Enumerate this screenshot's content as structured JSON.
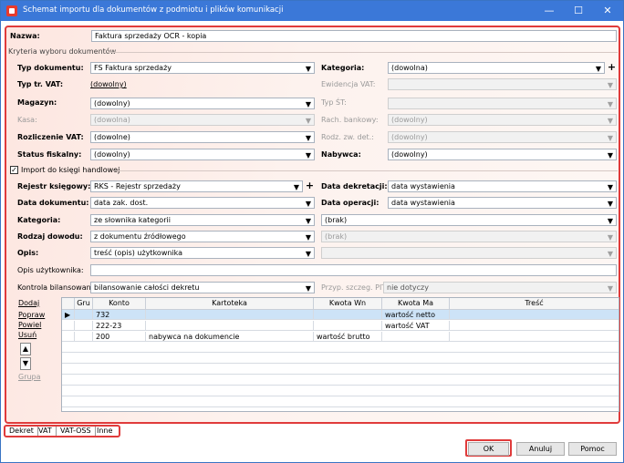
{
  "window": {
    "title": "Schemat importu dla dokumentów z podmiotu i plików komunikacji",
    "minimize": "—",
    "maximize": "☐",
    "close": "✕",
    "accent": "#3b78d8",
    "highlight": "#e03b3b"
  },
  "form": {
    "name_label": "Nazwa:",
    "name_value": "Faktura sprzedaży OCR - kopia",
    "criteria_header": "Kryteria wyboru dokumentów",
    "typ_dokumentu_label": "Typ dokumentu:",
    "typ_dokumentu_value": "FS Faktura sprzedaży",
    "kategoria_label": "Kategoria:",
    "kategoria_value": "(dowolna)",
    "typ_vat_label": "Typ tr. VAT:",
    "typ_vat_value": "(dowolny)",
    "ewidencja_vat_label": "Ewidencja VAT:",
    "ewidencja_vat_value": "",
    "magazyn_label": "Magazyn:",
    "magazyn_value": "(dowolny)",
    "typ_st_label": "Typ ŚT:",
    "typ_st_value": "",
    "kasa_label": "Kasa:",
    "kasa_value": "(dowolna)",
    "rach_bank_label": "Rach. bankowy:",
    "rach_bank_value": "(dowolny)",
    "rozliczenie_vat_label": "Rozliczenie VAT:",
    "rozliczenie_vat_value": "(dowolne)",
    "rodz_zw_label": "Rodz. zw. det.:",
    "rodz_zw_value": "(dowolny)",
    "status_fiskalny_label": "Status fiskalny:",
    "status_fiskalny_value": "(dowolny)",
    "nabywca_label": "Nabywca:",
    "nabywca_value": "(dowolny)",
    "import_checkbox_label": "Import do księgi handlowej",
    "import_checked": "✓",
    "rejestr_label": "Rejestr księgowy:",
    "rejestr_value": "RKS - Rejestr sprzedaży",
    "data_dekretacji_label": "Data dekretacji:",
    "data_dekretacji_value": "data wystawienia",
    "data_dokumentu_label": "Data dokumentu:",
    "data_dokumentu_value": "data zak. dost.",
    "data_operacji_label": "Data operacji:",
    "data_operacji_value": "data wystawienia",
    "kategoria2_label": "Kategoria:",
    "kategoria2_value": "ze słownika kategorii",
    "kategoria2_right_value": "(brak)",
    "rodzaj_dowodu_label": "Rodzaj dowodu:",
    "rodzaj_dowodu_value": "z dokumentu źródłowego",
    "rodzaj_dowodu_right_value": "(brak)",
    "opis_label": "Opis:",
    "opis_value": "treść (opis) użytkownika",
    "opis_right_value": "",
    "opis_uzytkownika_label": "Opis użytkownika:",
    "opis_uzytkownika_value": "",
    "kontrola_label": "Kontrola bilansowania:",
    "kontrola_value": "bilansowanie całości dekretu",
    "przyp_label": "Przyp. szczeg. PIT:",
    "przyp_value": "nie dotyczy",
    "plus": "+",
    "arrow": "▼"
  },
  "side_actions": {
    "dodaj": "Dodaj",
    "popraw": "Popraw",
    "powiel": "Powiel",
    "usun": "Usuń",
    "up": "▲",
    "down": "▼",
    "grupa": "Grupa"
  },
  "table": {
    "columns": [
      "Gru",
      "Konto",
      "Kartoteka",
      "Kwota Wn",
      "Kwota Ma",
      "Treść"
    ],
    "current_marker": "▶",
    "rows": [
      {
        "gru": "",
        "konto": "732",
        "kartoteka": "",
        "kwota_wn": "",
        "kwota_ma": "wartość netto",
        "tresc": ""
      },
      {
        "gru": "",
        "konto": "222-23",
        "kartoteka": "",
        "kwota_wn": "",
        "kwota_ma": "wartość VAT",
        "tresc": ""
      },
      {
        "gru": "",
        "konto": "200",
        "kartoteka": "nabywca na dokumencie",
        "kwota_wn": "wartość brutto",
        "kwota_ma": "",
        "tresc": ""
      }
    ]
  },
  "tabs": [
    "Dekret",
    "VAT",
    "VAT-OSS",
    "Inne"
  ],
  "buttons": {
    "ok": "OK",
    "anuluj": "Anuluj",
    "pomoc": "Pomoc"
  }
}
